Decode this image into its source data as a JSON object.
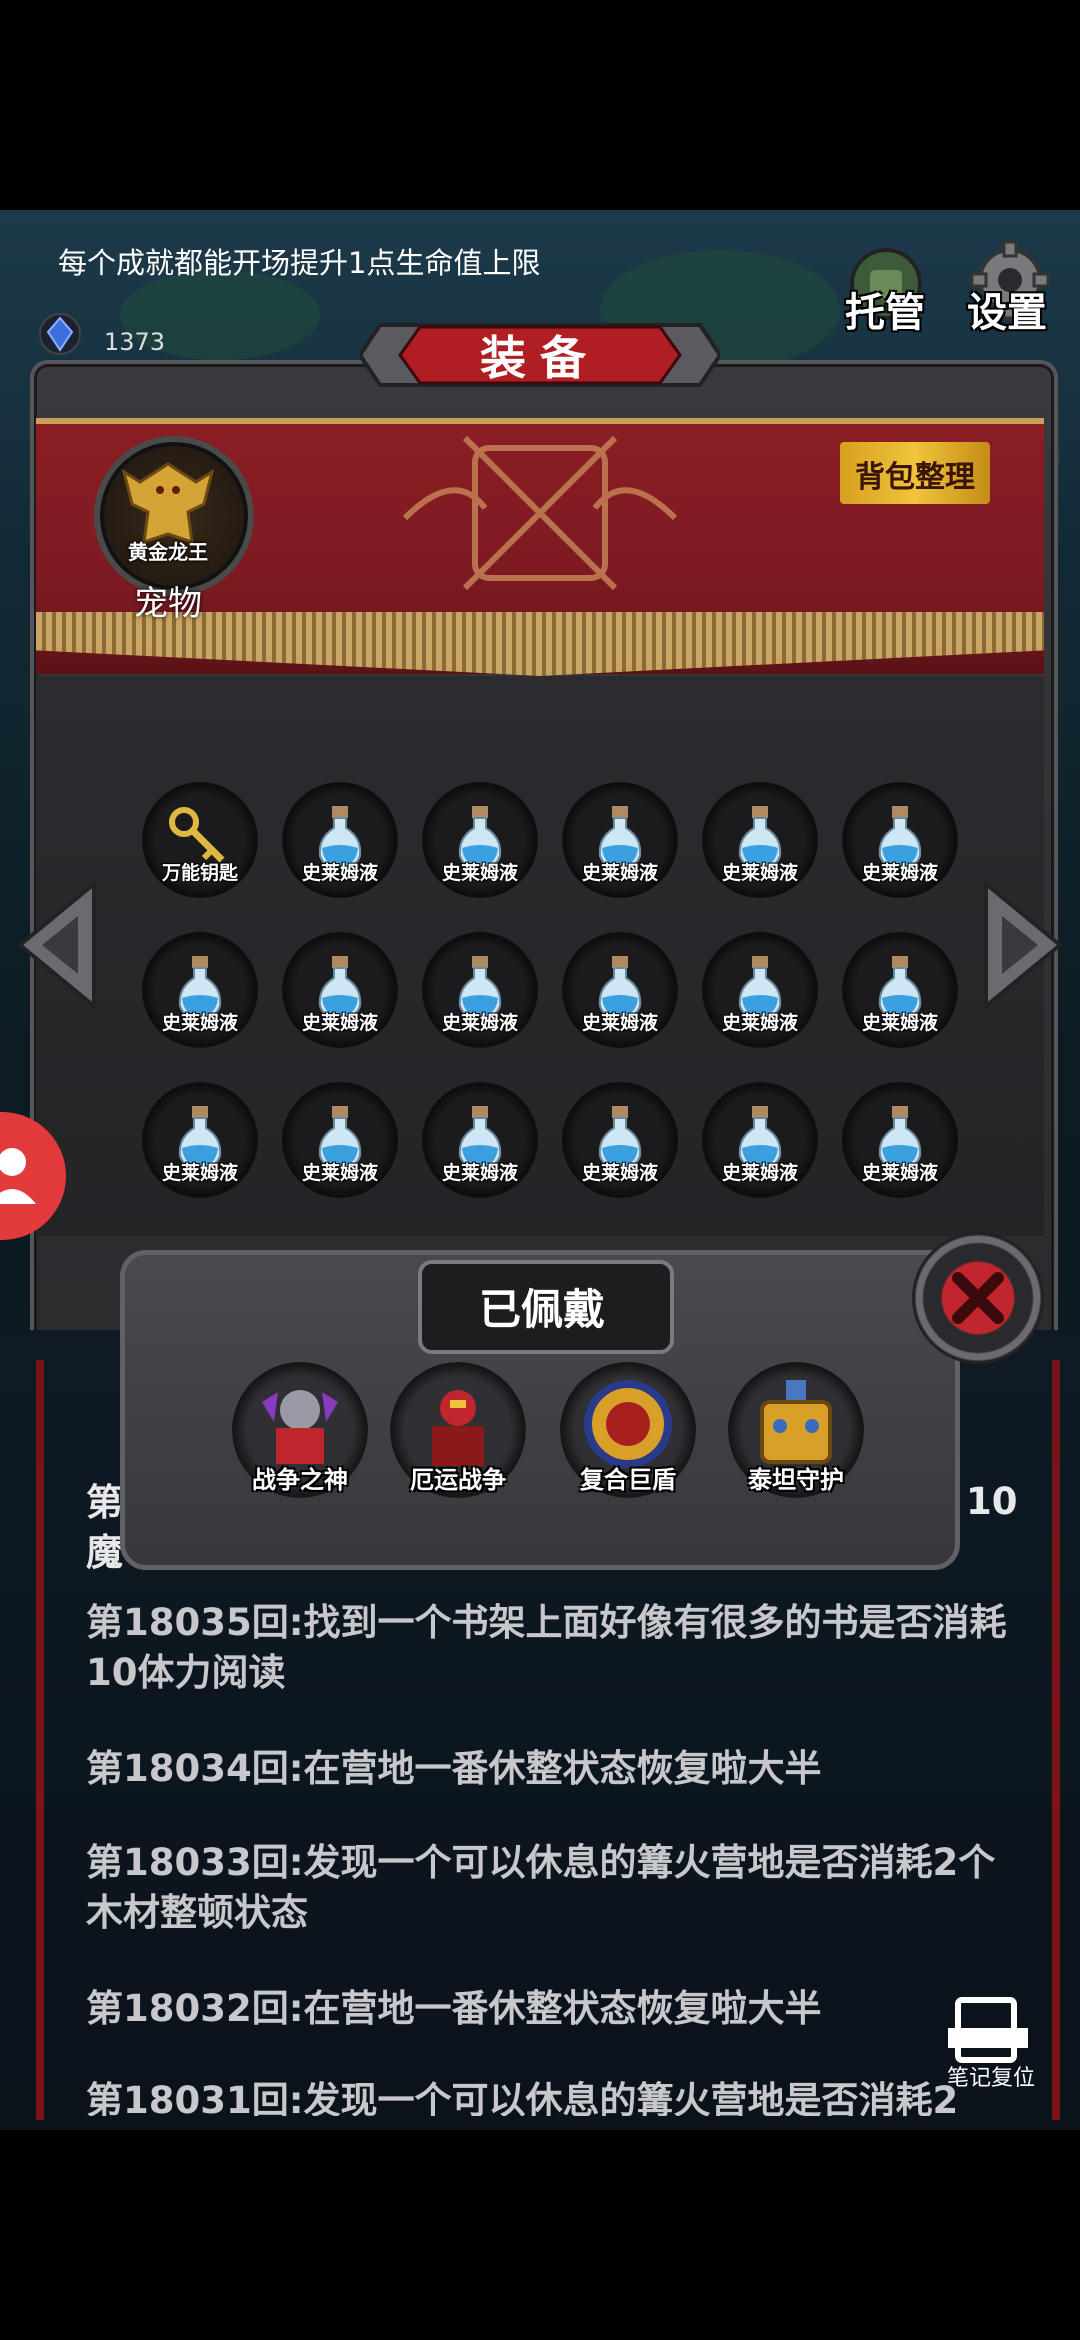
{
  "hint": {
    "text": "每个成就都能开场提升1点生命值上限"
  },
  "currency": {
    "value": "1373"
  },
  "top_buttons": {
    "auto_label": "托管",
    "settings_label": "设置"
  },
  "equipment_panel": {
    "title": "装备",
    "sort_button": "背包整理",
    "pet": {
      "name": "黄金龙王",
      "label": "宠物"
    },
    "items": [
      {
        "name": "万能钥匙",
        "icon": "key-icon"
      },
      {
        "name": "史莱姆液",
        "icon": "potion-icon"
      },
      {
        "name": "史莱姆液",
        "icon": "potion-icon"
      },
      {
        "name": "史莱姆液",
        "icon": "potion-icon"
      },
      {
        "name": "史莱姆液",
        "icon": "potion-icon"
      },
      {
        "name": "史莱姆液",
        "icon": "potion-icon"
      },
      {
        "name": "史莱姆液",
        "icon": "potion-icon"
      },
      {
        "name": "史莱姆液",
        "icon": "potion-icon"
      },
      {
        "name": "史莱姆液",
        "icon": "potion-icon"
      },
      {
        "name": "史莱姆液",
        "icon": "potion-icon"
      },
      {
        "name": "史莱姆液",
        "icon": "potion-icon"
      },
      {
        "name": "史莱姆液",
        "icon": "potion-icon"
      },
      {
        "name": "史莱姆液",
        "icon": "potion-icon"
      },
      {
        "name": "史莱姆液",
        "icon": "potion-icon"
      },
      {
        "name": "史莱姆液",
        "icon": "potion-icon"
      },
      {
        "name": "史莱姆液",
        "icon": "potion-icon"
      },
      {
        "name": "史莱姆液",
        "icon": "potion-icon"
      },
      {
        "name": "史莱姆液",
        "icon": "potion-icon"
      }
    ]
  },
  "equipped": {
    "title": "已佩戴",
    "items": [
      {
        "name": "战争之神"
      },
      {
        "name": "厄运战争"
      },
      {
        "name": "复合巨盾"
      },
      {
        "name": "泰坦守护"
      }
    ]
  },
  "log": {
    "partial_top_left": "第",
    "partial_top_left_2": "魔",
    "partial_top_right": "10",
    "entries": [
      "第18035回:找到一个书架上面好像有很多的书是否消耗10体力阅读",
      "第18034回:在营地一番休整状态恢复啦大半",
      "第18033回:发现一个可以休息的篝火营地是否消耗2个木材整顿状态",
      "第18032回:在营地一番休整状态恢复啦大半",
      "第18031回:发现一个可以休息的篝火营地是否消耗2"
    ]
  },
  "note_reset": {
    "label": "笔记复位"
  },
  "colors": {
    "banner_red": "#8a1e24",
    "gold": "#c8a05a",
    "close_red": "#c0262c"
  }
}
